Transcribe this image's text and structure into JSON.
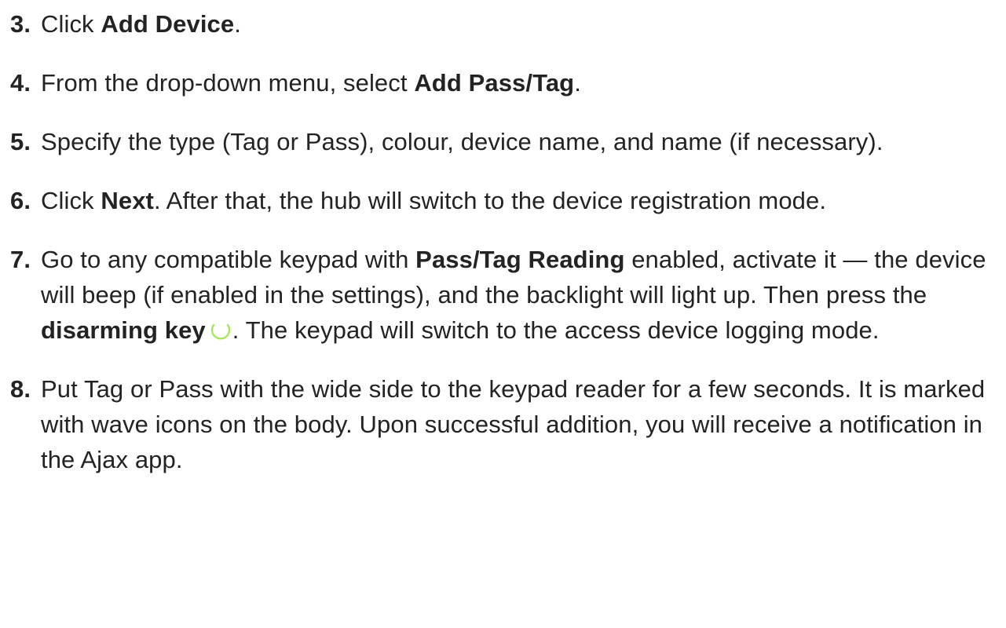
{
  "steps": [
    {
      "number": "3.",
      "pre": "Click ",
      "bold": "Add Device",
      "post": "."
    },
    {
      "number": "4.",
      "pre": "From the drop-down menu, select ",
      "bold": "Add Pass/Tag",
      "post": "."
    },
    {
      "number": "5.",
      "text": "Specify the type (Tag or Pass), colour, device name, and name (if necessary)."
    },
    {
      "number": "6.",
      "pre": "Click ",
      "bold": "Next",
      "post": ". After that, the hub will switch to the device registration mode."
    },
    {
      "number": "7.",
      "pre": "Go to any compatible keypad with ",
      "bold": "Pass/Tag Reading",
      "mid": " enabled, activate it — the device will beep (if enabled in the settings), and the backlight will light up. Then press the ",
      "bold2": "disarming key",
      "post": ". The keypad will switch to the access device logging mode."
    },
    {
      "number": "8.",
      "text": "Put Tag or Pass with the wide side to the keypad reader for a few seconds. It is marked with wave icons on the body. Upon successful addition, you will receive a notification in the Ajax app."
    }
  ],
  "icons": {
    "disarm_key": "disarm-circle-icon",
    "disarm_color": "#a8e65a"
  }
}
